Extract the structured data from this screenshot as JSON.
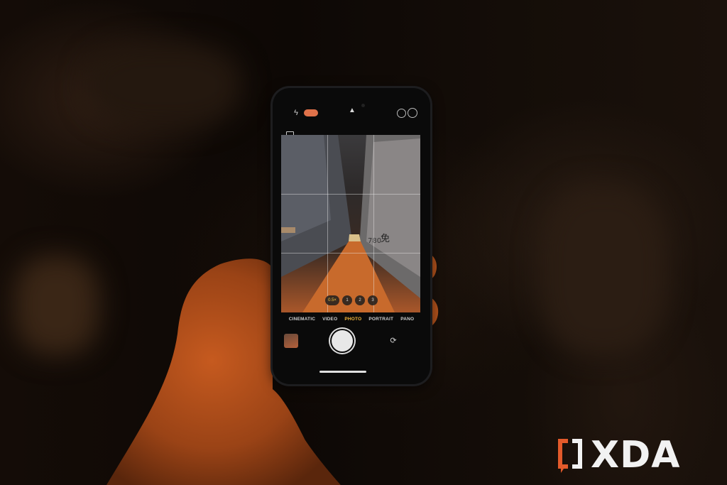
{
  "camera_app": {
    "top_bar": {
      "flash_icon": "flash-off-icon",
      "chevron_icon": "chevron-up-icon"
    },
    "zoom_levels": [
      "0.5×",
      "1",
      "2",
      "3"
    ],
    "modes": [
      "CINEMATIC",
      "VIDEO",
      "PHOTO",
      "PORTRAIT",
      "PANO"
    ],
    "selected_mode": "PHOTO"
  },
  "watermark": {
    "text": "XDA",
    "accent_color": "#e35a2b"
  },
  "colors": {
    "live_badge": "#e0724a",
    "mode_active": "#f4b73c",
    "zoom_active": "#f4c542"
  }
}
